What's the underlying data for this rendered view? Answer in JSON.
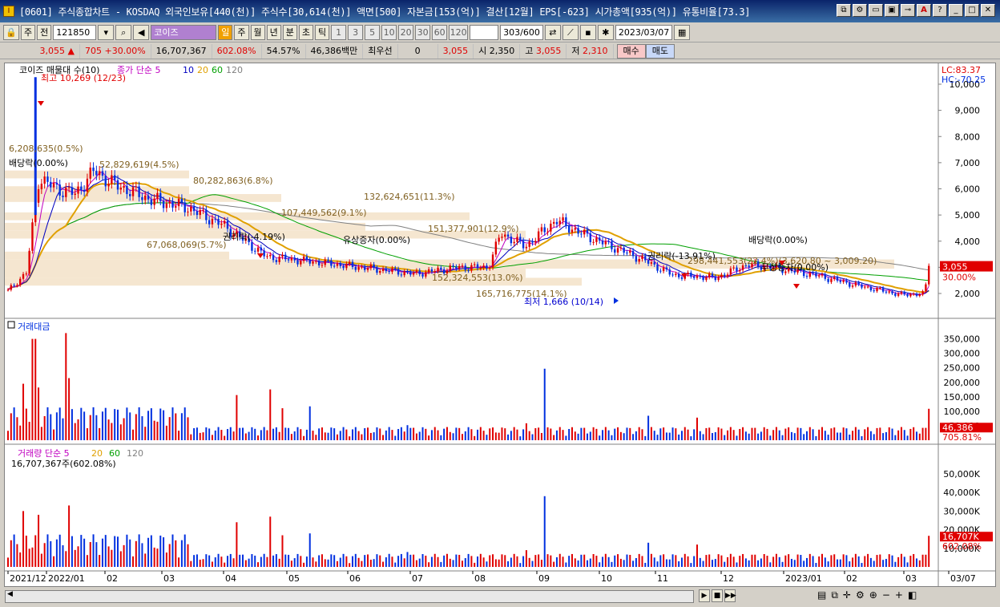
{
  "window": {
    "title": "[0601] 주식종합차트 - KOSDAQ 외국인보유[440(천)] 주식수[30,614(천)] 액면[500] 자본금[153(억)] 결산[12월] EPS[-623] 시가총액[935(억)] 유통비율[73.3]"
  },
  "toolbar": {
    "period": "주",
    "prev": "전",
    "code": "121850",
    "stock_name": "코이즈",
    "intervals": [
      "일",
      "주",
      "월",
      "년",
      "분",
      "초",
      "틱"
    ],
    "nums": [
      "1",
      "3",
      "5",
      "10",
      "20",
      "30",
      "60",
      "120"
    ],
    "count": "303",
    "total": "/600",
    "date": "2023/03/07"
  },
  "info": {
    "price": "3,055",
    "change": "705 +30.00%",
    "volume": "16,707,367",
    "vol_ratio": "602.08%",
    "turnover": "54.57%",
    "amount": "46,386백만",
    "best": "최우선",
    "zero": "0",
    "ask": "3,055",
    "open_label": "시",
    "open": "2,350",
    "high_label": "고",
    "high": "3,055",
    "low_label": "저",
    "low": "2,310",
    "buy": "매수",
    "sell": "매도"
  },
  "price_panel": {
    "title": "코이즈 매물대 수(10)",
    "ma_label": "종가 단순 5",
    "ma_periods": [
      "10",
      "20",
      "60",
      "120"
    ],
    "lc": "LC:83.37",
    "hc": "HC:-70.25",
    "yticks": [
      "10,000",
      "9,000",
      "8,000",
      "7,000",
      "6,000",
      "5,000",
      "4,000",
      "3,000",
      "2,000"
    ],
    "price_tag": "3,055",
    "pct_tag": "30.00%",
    "annotations": [
      {
        "t": "최고 10,269 (12/23)",
        "c": "#e00000"
      },
      {
        "t": "6,208,635(0.5%)",
        "c": "#806020"
      },
      {
        "t": "배당락(0.00%)",
        "c": "#000"
      },
      {
        "t": "52,829,619(4.5%)",
        "c": "#806020"
      },
      {
        "t": "80,282,863(6.8%)",
        "c": "#806020"
      },
      {
        "t": "132,624,651(11.3%)",
        "c": "#806020"
      },
      {
        "t": "107,449,562(9.1%)",
        "c": "#806020"
      },
      {
        "t": "151,377,901(12.9%)",
        "c": "#806020"
      },
      {
        "t": "67,068,069(5.7%)",
        "c": "#806020"
      },
      {
        "t": "권리락(-4.19%)",
        "c": "#000"
      },
      {
        "t": "유상증자(0.00%)",
        "c": "#000"
      },
      {
        "t": "152,324,553(13.0%)",
        "c": "#806020"
      },
      {
        "t": "165,716,775(14.1%)",
        "c": "#806020"
      },
      {
        "t": "최저 1,666 (10/14)",
        "c": "#0000d0"
      },
      {
        "t": "권리락(-13.91%)",
        "c": "#000"
      },
      {
        "t": "298,441,553(22.4%)(3,620.80 ~ 3,009.20)",
        "c": "#806020"
      },
      {
        "t": "배당락(0.00%)",
        "c": "#000"
      },
      {
        "t": "무상증자(0.00%)",
        "c": "#000"
      }
    ]
  },
  "amount_panel": {
    "title": "거래대금",
    "yticks": [
      "350,000",
      "300,000",
      "250,000",
      "200,000",
      "150,000",
      "100,000",
      "50,000"
    ],
    "tag": "46,386",
    "pct": "705.81%"
  },
  "volume_panel": {
    "title": "거래량 단순 5",
    "ma_periods": [
      "20",
      "60",
      "120"
    ],
    "sub": "16,707,367주(602.08%)",
    "yticks": [
      "50,000K",
      "40,000K",
      "30,000K",
      "20,000K",
      "10,000K"
    ],
    "tag": "16,707K",
    "pct": "602.08%"
  },
  "xaxis": [
    "2021/12",
    "2022/01",
    "02",
    "03",
    "04",
    "05",
    "06",
    "07",
    "08",
    "09",
    "10",
    "11",
    "12",
    "2023/01",
    "02",
    "03",
    "03/07"
  ],
  "colors": {
    "up": "#e00000",
    "down": "#0030e0",
    "ma5": "#c000c0",
    "ma10": "#0000c0",
    "ma20": "#e0a000",
    "ma60": "#00a000",
    "ma120": "#808080",
    "volprofile": "#f5e6d0"
  }
}
